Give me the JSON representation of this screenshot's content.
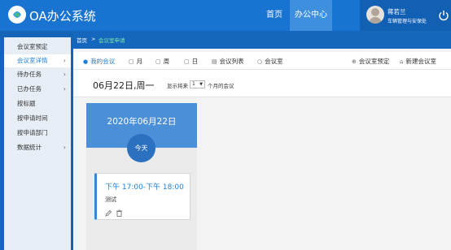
{
  "header": {
    "app_title": "OA办公系统",
    "nav": [
      {
        "label": "首页"
      },
      {
        "label": "办公中心"
      }
    ],
    "user": {
      "name": "蒋若兰",
      "dept": "车辆管理与安保处"
    },
    "colors": {
      "header_bg": "#1874d0",
      "active_nav": "#3e8fdd"
    }
  },
  "sidebar": {
    "items": [
      {
        "label": "会议室预定",
        "has_chevron": false
      },
      {
        "label": "会议室详情",
        "has_chevron": true
      },
      {
        "label": "待办任务",
        "has_chevron": true
      },
      {
        "label": "已办任务",
        "has_chevron": true
      },
      {
        "label": "按标题",
        "has_chevron": false
      },
      {
        "label": "按申请时间",
        "has_chevron": false
      },
      {
        "label": "按申请部门",
        "has_chevron": false
      },
      {
        "label": "数据统计",
        "has_chevron": true
      }
    ],
    "active_index": 1
  },
  "breadcrumb": {
    "home": "首页",
    "separator": ">",
    "current": "会议室申请"
  },
  "toolbar": {
    "my_meetings": "我的会议",
    "month": "月",
    "week": "周",
    "day": "日",
    "list": "会议列表",
    "rooms": "会议室",
    "book": "会议室预定",
    "new_room": "新建会议室"
  },
  "subheader": {
    "date": "06月22日,周一",
    "show_prefix": "显示将来",
    "months_value": "1",
    "show_suffix": "个月的会议"
  },
  "day_card": {
    "title": "2020年06月22日",
    "today_label": "今天"
  },
  "event": {
    "time": "下午 17:00-下午 18:00",
    "title": "测试"
  }
}
